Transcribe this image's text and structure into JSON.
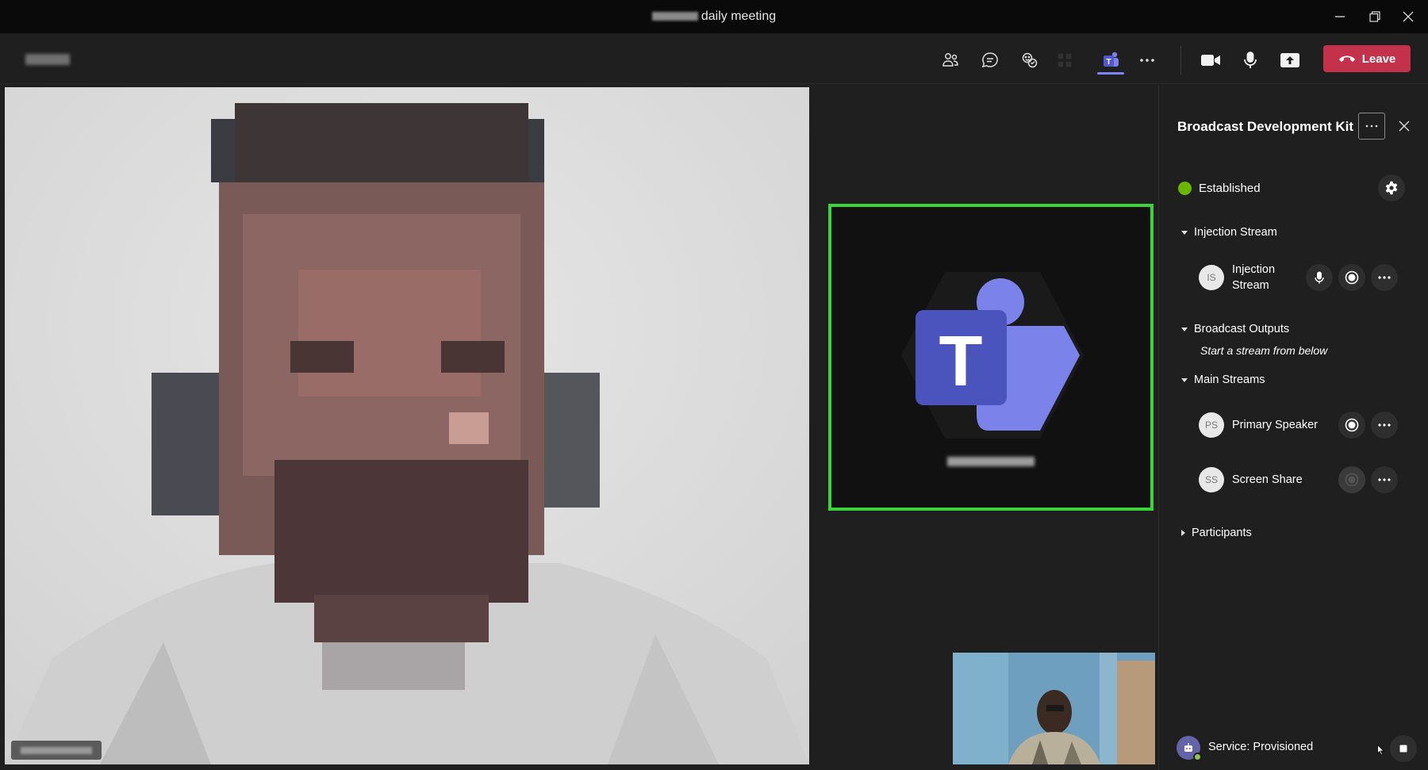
{
  "window": {
    "title": "daily meeting",
    "controls": [
      "minimize-icon",
      "restore-icon",
      "close-icon"
    ]
  },
  "toolbar": {
    "icons": [
      "people-icon",
      "chat-icon",
      "reactions-icon",
      "apps-icon",
      "more-icon",
      "camera-icon",
      "microphone-icon",
      "share-screen-icon"
    ],
    "leave_label": "Leave"
  },
  "panel": {
    "title": "Broadcast Development Kit",
    "status": "Established",
    "status_color": "#6bb700",
    "sections": {
      "injection": {
        "label": "Injection Stream",
        "stream": {
          "initials": "IS",
          "line1": "Injection",
          "line2": "Stream"
        }
      },
      "outputs": {
        "label": "Broadcast Outputs",
        "hint": "Start a stream from below"
      },
      "main": {
        "label": "Main Streams",
        "streams": [
          {
            "initials": "PS",
            "label": "Primary Speaker",
            "enabled": true
          },
          {
            "initials": "SS",
            "label": "Screen Share",
            "enabled": false
          }
        ]
      },
      "participants": {
        "label": "Participants"
      }
    },
    "service": {
      "label": "Service: Provisioned"
    }
  },
  "colors": {
    "accent": "#7f85f5",
    "leave": "#c4314b",
    "speaking_border": "#3cd43c",
    "teams_purple": "#5059c9"
  }
}
